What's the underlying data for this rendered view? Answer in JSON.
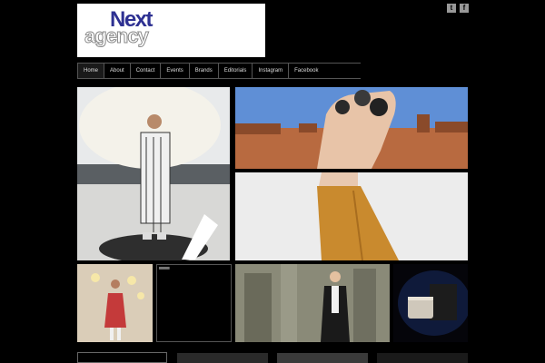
{
  "logo": {
    "line1": "Next",
    "line2": "agency"
  },
  "social": {
    "twitter_label": "t",
    "facebook_label": "f"
  },
  "nav": [
    {
      "label": "Home"
    },
    {
      "label": "About"
    },
    {
      "label": "Contact"
    },
    {
      "label": "Events"
    },
    {
      "label": "Brands"
    },
    {
      "label": "Editorials"
    },
    {
      "label": "Instagram"
    },
    {
      "label": "Facebook"
    }
  ],
  "tiles": [
    {
      "name": "umbrella-model-photo"
    },
    {
      "name": "desert-rings-photo"
    },
    {
      "name": "mustard-trousers-photo"
    },
    {
      "name": "dress-model-photo"
    },
    {
      "name": "dark-video-tile"
    },
    {
      "name": "ruins-model-photo"
    },
    {
      "name": "cosmetics-product-photo"
    }
  ],
  "colors": {
    "background": "#000000",
    "logo_blue": "#2e3192",
    "nav_border": "#555555"
  }
}
